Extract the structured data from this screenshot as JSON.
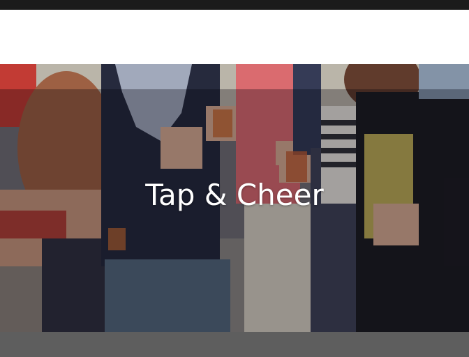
{
  "hero": {
    "title": "Tap & Cheer",
    "photo_subject": "crowd-with-beer-cups"
  },
  "colors": {
    "top_bar": "#1b1b1b",
    "header_bg": "#ffffff",
    "footer_bar": "#5e5e5e",
    "title_text": "#ffffff"
  }
}
